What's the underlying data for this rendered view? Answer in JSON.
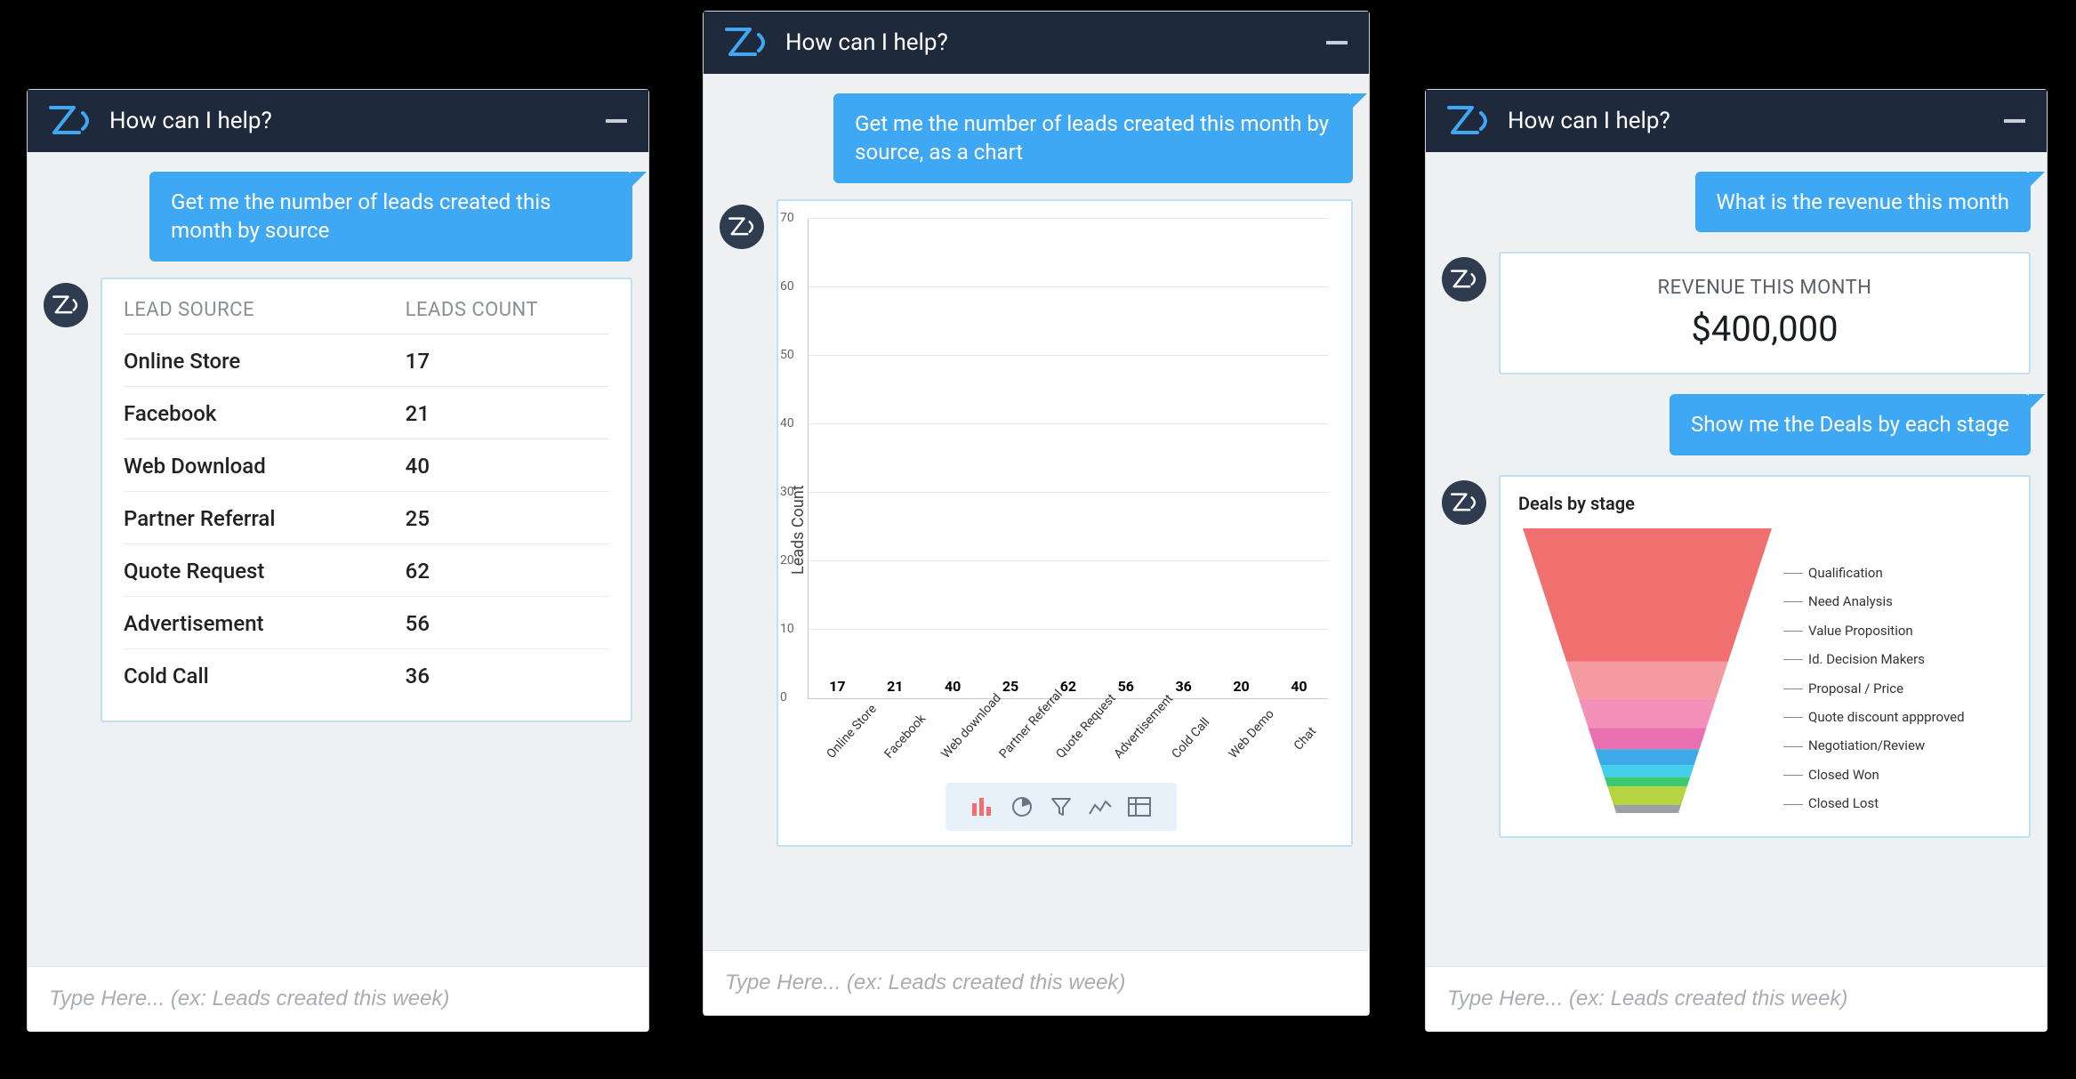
{
  "common": {
    "header_title": "How can I help?",
    "input_placeholder": "Type Here... (ex: Leads created this week)"
  },
  "panel1": {
    "user_msg": "Get me the number of leads created this month by source",
    "table": {
      "col1": "LEAD SOURCE",
      "col2": "LEADS COUNT",
      "rows": [
        {
          "source": "Online Store",
          "count": "17"
        },
        {
          "source": "Facebook",
          "count": "21"
        },
        {
          "source": "Web Download",
          "count": "40"
        },
        {
          "source": "Partner Referral",
          "count": "25"
        },
        {
          "source": "Quote Request",
          "count": "62"
        },
        {
          "source": "Advertisement",
          "count": "56"
        },
        {
          "source": "Cold Call",
          "count": "36"
        }
      ]
    }
  },
  "panel2": {
    "user_msg": "Get me the number of leads created this month by source, as a chart",
    "ylabel": "Leads Count",
    "ticks": [
      "0",
      "10",
      "20",
      "30",
      "40",
      "50",
      "60",
      "70"
    ]
  },
  "panel3": {
    "user_msg1": "What is the revenue this month",
    "rev_label": "REVENUE THIS MONTH",
    "rev_value": "$400,000",
    "user_msg2": "Show me the Deals by each stage",
    "funnel_title": "Deals by stage",
    "funnel_stages": [
      "Qualification",
      "Need Analysis",
      "Value Proposition",
      "Id. Decision Makers",
      "Proposal / Price",
      "Quote discount appproved",
      "Negotiation/Review",
      "Closed Won",
      "Closed Lost"
    ]
  },
  "chart_data": [
    {
      "type": "bar",
      "title": "",
      "xlabel": "",
      "ylabel": "Leads Count",
      "ylim": [
        0,
        70
      ],
      "categories": [
        "Online Store",
        "Facebook",
        "Web download",
        "Partner Referral",
        "Quote Request",
        "Advertisement",
        "Cold Call",
        "Web Demo",
        "Chat"
      ],
      "values": [
        17,
        21,
        40,
        25,
        62,
        56,
        36,
        20,
        40
      ],
      "colors": [
        "#F26D6D",
        "#F67FB8",
        "#8C59D9",
        "#2E8CE0",
        "#2BC6ED",
        "#3CCB72",
        "#3CB55A",
        "#B6D340",
        "#F28A3C"
      ]
    },
    {
      "type": "funnel",
      "title": "Deals by stage",
      "categories": [
        "Qualification",
        "Need Analysis",
        "Value Proposition",
        "Id. Decision Makers",
        "Proposal / Price",
        "Quote discount appproved",
        "Negotiation/Review",
        "Closed Won",
        "Closed Lost"
      ],
      "values": [
        100,
        28,
        22,
        16,
        12,
        9,
        7,
        14,
        6
      ],
      "colors": [
        "#F07070",
        "#F49AA0",
        "#F590B8",
        "#E86FB0",
        "#3FA8E8",
        "#42CFEB",
        "#3CC96F",
        "#B6D340",
        "#9AA0A6"
      ]
    }
  ]
}
